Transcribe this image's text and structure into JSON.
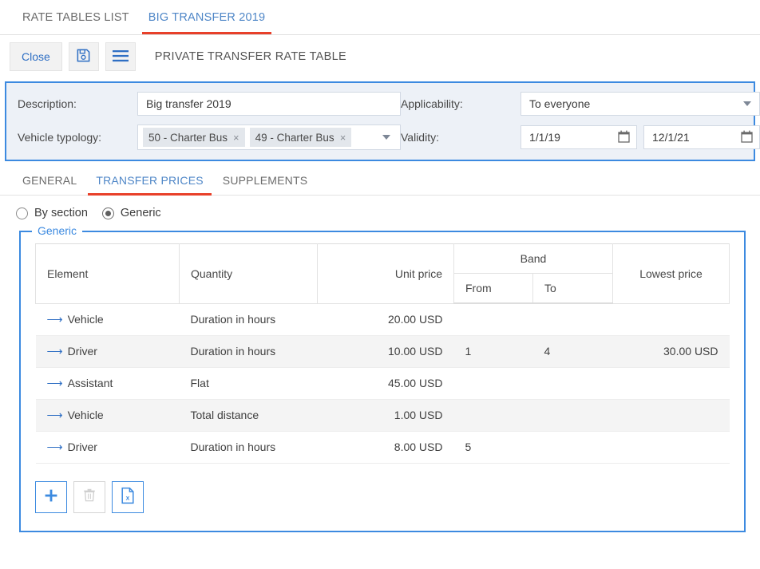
{
  "tabs": {
    "items": [
      {
        "label": "RATE TABLES LIST",
        "active": false
      },
      {
        "label": "BIG TRANSFER 2019",
        "active": true
      }
    ]
  },
  "toolbar": {
    "close_label": "Close",
    "save_icon": "save-floppy-icon",
    "menu_icon": "hamburger-menu-icon",
    "title": "PRIVATE TRANSFER RATE TABLE"
  },
  "form": {
    "description_label": "Description:",
    "description_value": "Big transfer 2019",
    "applicability_label": "Applicability:",
    "applicability_value": "To everyone",
    "vehicle_typology_label": "Vehicle typology:",
    "vehicle_typology_chips": [
      {
        "label": "50 - Charter Bus",
        "remove": "×"
      },
      {
        "label": "49 - Charter Bus",
        "remove": "×"
      }
    ],
    "validity_label": "Validity:",
    "validity_from": "1/1/19",
    "validity_to": "12/1/21"
  },
  "subtabs": {
    "items": [
      {
        "label": "GENERAL",
        "active": false
      },
      {
        "label": "TRANSFER PRICES",
        "active": true
      },
      {
        "label": "SUPPLEMENTS",
        "active": false
      }
    ]
  },
  "mode": {
    "options": [
      {
        "label": "By section",
        "checked": false
      },
      {
        "label": "Generic",
        "checked": true
      }
    ]
  },
  "generic_section": {
    "legend": "Generic",
    "table": {
      "headers": {
        "element": "Element",
        "quantity": "Quantity",
        "unit_price": "Unit price",
        "band": "Band",
        "band_from": "From",
        "band_to": "To",
        "lowest_price": "Lowest price"
      },
      "rows": [
        {
          "element": "Vehicle",
          "quantity": "Duration in hours",
          "unit_price": "20.00 USD",
          "from": "",
          "to": "",
          "lowest_price": ""
        },
        {
          "element": "Driver",
          "quantity": "Duration in hours",
          "unit_price": "10.00 USD",
          "from": "1",
          "to": "4",
          "lowest_price": "30.00 USD"
        },
        {
          "element": "Assistant",
          "quantity": "Flat",
          "unit_price": "45.00 USD",
          "from": "",
          "to": "",
          "lowest_price": ""
        },
        {
          "element": "Vehicle",
          "quantity": "Total distance",
          "unit_price": "1.00 USD",
          "from": "",
          "to": "",
          "lowest_price": ""
        },
        {
          "element": "Driver",
          "quantity": "Duration in hours",
          "unit_price": "8.00 USD",
          "from": "5",
          "to": "",
          "lowest_price": ""
        }
      ]
    },
    "actions": [
      {
        "name": "add-row-button",
        "icon": "plus-icon",
        "disabled": false
      },
      {
        "name": "delete-row-button",
        "icon": "trash-icon",
        "disabled": true
      },
      {
        "name": "export-excel-button",
        "icon": "excel-file-icon",
        "disabled": false
      }
    ]
  },
  "colors": {
    "accent_blue": "#3c8ae0",
    "link_blue": "#2f6fc4",
    "tab_blue": "#4e86c7",
    "underline_red": "#e8402a",
    "panel_bg": "#edf1f7",
    "row_stripe": "#f4f4f4"
  }
}
